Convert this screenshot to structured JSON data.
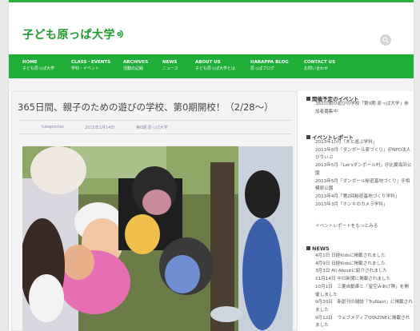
{
  "site": {
    "title": "子ども原っぱ大学",
    "leaf_icon": "leaf-icon"
  },
  "nav": [
    {
      "en": "HOME",
      "jp": "子ども原っぱ大学"
    },
    {
      "en": "CLASS・EVENTS",
      "jp": "学科・イベント"
    },
    {
      "en": "ARCHIVES",
      "jp": "活動の記録"
    },
    {
      "en": "NEWS",
      "jp": "ニュース"
    },
    {
      "en": "ABOUT US",
      "jp": "子ども原っぱ大学とは"
    },
    {
      "en": "HARAPPA BLOG",
      "jp": "原っぱブログ"
    },
    {
      "en": "CONTACT US",
      "jp": "お問い合わせ"
    }
  ],
  "post": {
    "title": "365日間、親子のための遊びの学校、第0期開校！（2/28〜）",
    "author": "tukepontas",
    "date": "2015年1月14日",
    "category": "第0期 原っぱ大学"
  },
  "sidebar": {
    "upcoming_head": "開催予定のイベント",
    "upcoming_text": "365日間の遊びの学校「第0期 原っぱ大学」参加者募集中",
    "reports_head": "イベントレポート",
    "reports": [
      "2013年10月「木と遊ぶ学科」",
      "2013年8月「ダンボール家づくり」＠NPO法人びりぃぶ",
      "2013年5月「Let'sダンボール村」＠比翼海浜公園",
      "2013年5月「ダンボール秘密基地づくり」＠相模原公園",
      "2013年4月「第2回秘密基地づくり学科」",
      "2013年3月「ホンキのカメラ学科」"
    ],
    "reports_more": "イベントレポートをもっとみる",
    "news_head": "NEWS",
    "news": [
      "4月1日 日経Kidsに掲載されました",
      "4月9日 日経Kidsに掲載されました",
      "3月3日 All Aboutに紹介されました",
      "11月14日 中日新聞に掲載されました",
      "10月1日　三菱自動車と「星空みあげ隊」を開催しました",
      "9月20日　新創刊の雑誌「TruNant」に掲載されました",
      "9月12日　ウェブメディアOYAZINEに掲載されました"
    ]
  },
  "colors": {
    "accent": "#1fae37",
    "title_green": "#1f9a2f"
  }
}
